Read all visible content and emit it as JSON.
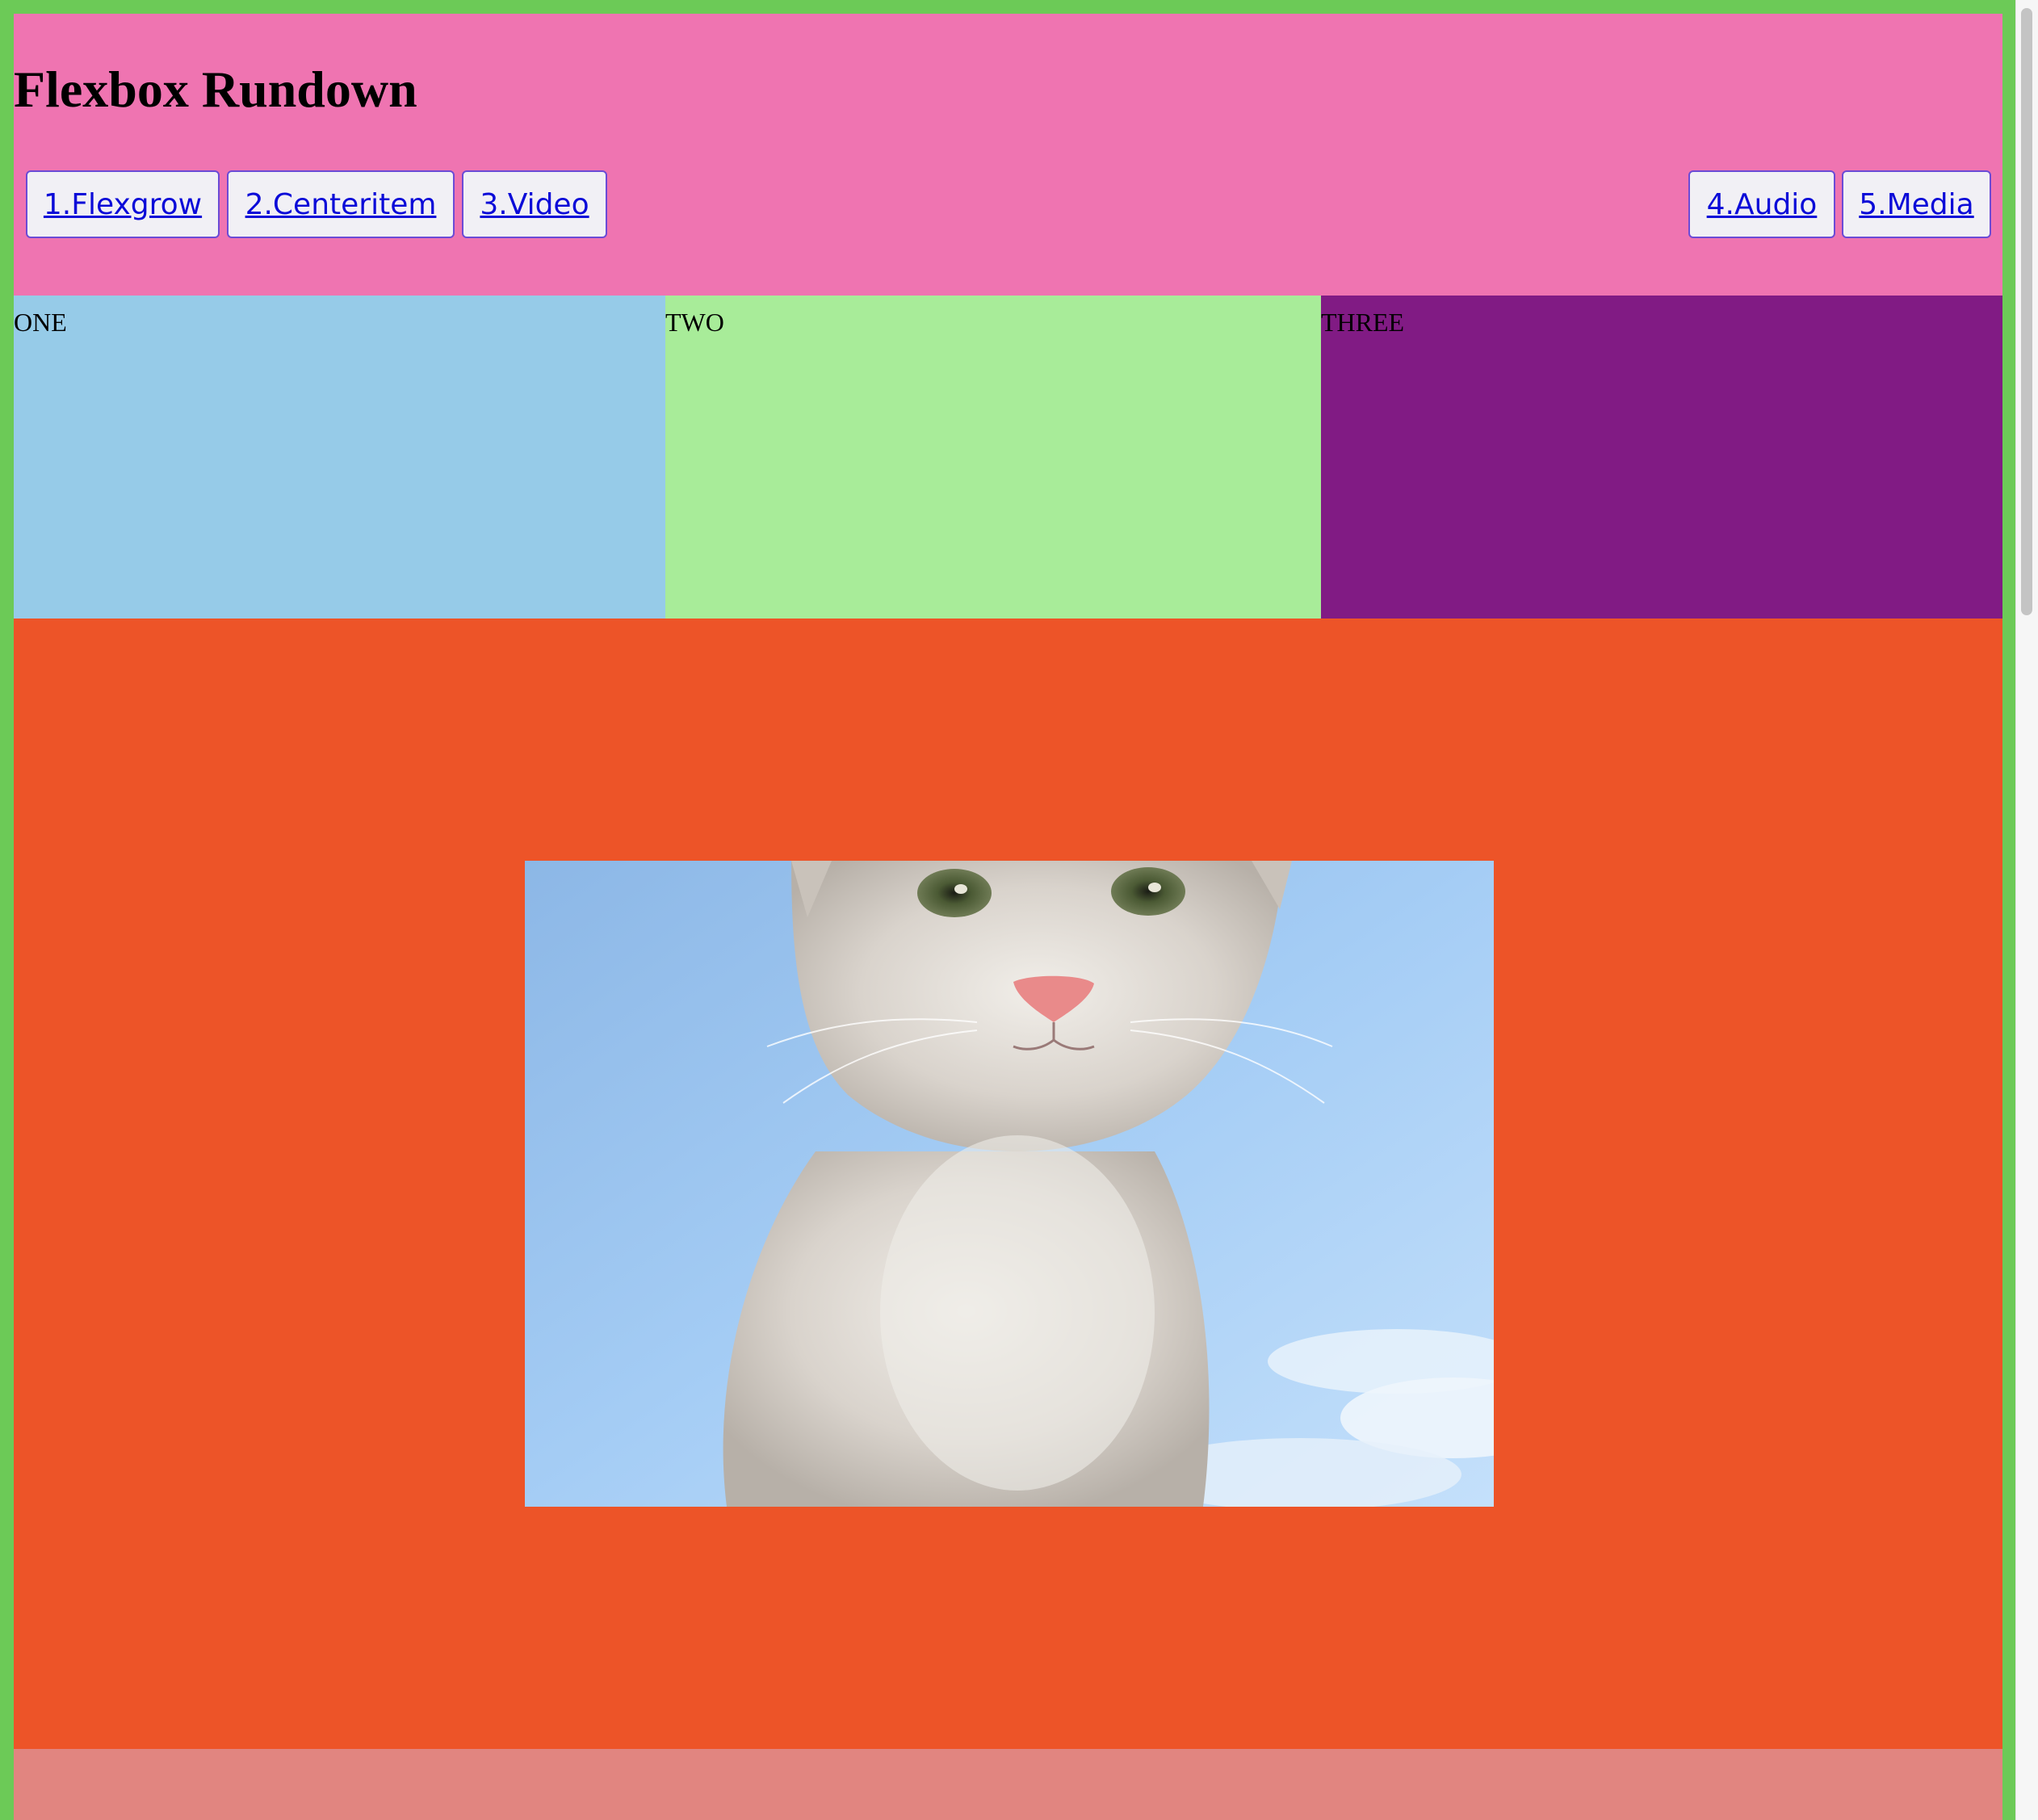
{
  "header": {
    "title": "Flexbox Rundown",
    "background": "#ef74b1",
    "nav": [
      {
        "label": "1.Flexgrow"
      },
      {
        "label": "2.Centeritem"
      },
      {
        "label": "3.Video"
      },
      {
        "label": "4.Audio"
      },
      {
        "label": "5.Media"
      }
    ],
    "link_color": "#0b0bd8"
  },
  "panels": [
    {
      "label": "ONE",
      "color": "#96cbe8"
    },
    {
      "label": "TWO",
      "color": "#a8ec99"
    },
    {
      "label": "THREE",
      "color": "#811b84"
    }
  ],
  "hero": {
    "background": "#ed5428",
    "image": "kitten photo against blue sky"
  },
  "footer": {
    "background": "#e18580"
  },
  "frame": {
    "border_color": "#6cca57"
  }
}
